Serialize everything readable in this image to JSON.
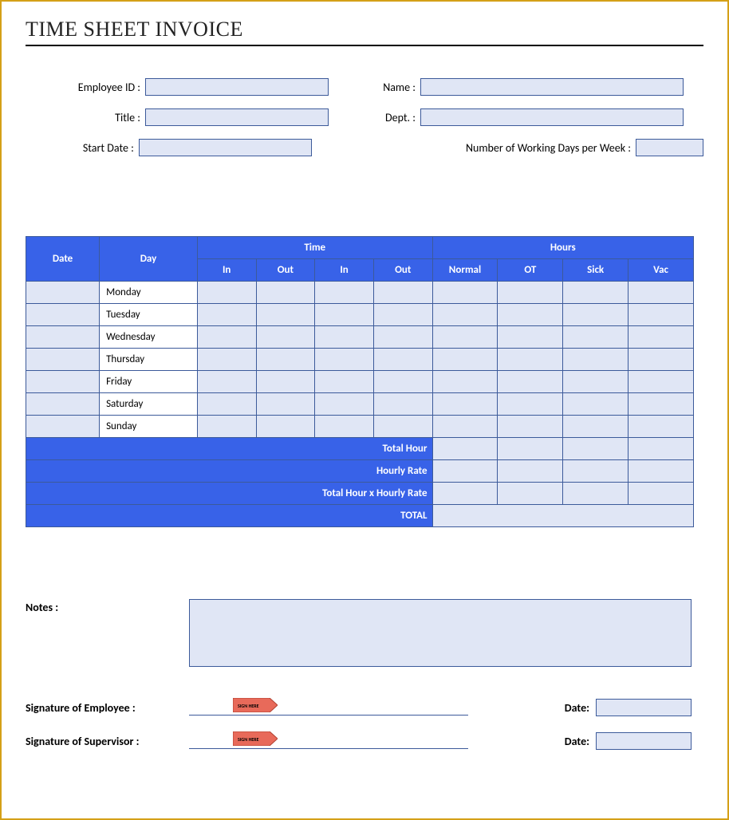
{
  "title": "TIME SHEET INVOICE",
  "form": {
    "employee_id_label": "Employee ID :",
    "name_label": "Name :",
    "title_label": "Title :",
    "dept_label": "Dept. :",
    "start_date_label": "Start Date :",
    "working_days_label": "Number of Working Days per Week :",
    "employee_id": "",
    "name": "",
    "title": "",
    "dept": "",
    "start_date": "",
    "working_days": ""
  },
  "table": {
    "header": {
      "date": "Date",
      "day": "Day",
      "time": "Time",
      "hours": "Hours",
      "in": "In",
      "out": "Out",
      "normal": "Normal",
      "ot": "OT",
      "sick": "Sick",
      "vac": "Vac"
    },
    "days": [
      "Monday",
      "Tuesday",
      "Wednesday",
      "Thursday",
      "Friday",
      "Saturday",
      "Sunday"
    ],
    "totals": {
      "total_hour": "Total Hour",
      "hourly_rate": "Hourly Rate",
      "total_x_rate": "Total Hour x Hourly Rate",
      "total": "TOTAL"
    }
  },
  "notes": {
    "label": "Notes :",
    "value": ""
  },
  "signatures": {
    "employee_label": "Signature of Employee :",
    "supervisor_label": "Signature of Supervisor :",
    "date_label": "Date:",
    "stamp_text": "SIGN HERE"
  }
}
